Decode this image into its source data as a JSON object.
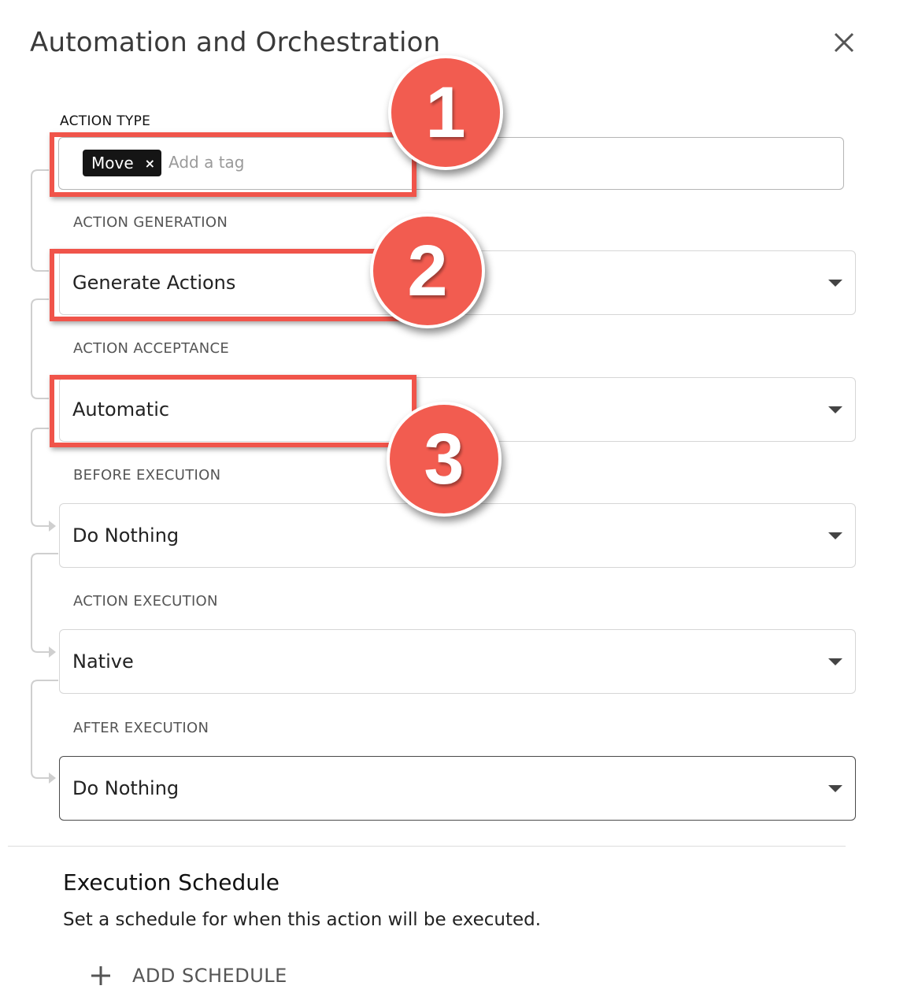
{
  "dialog": {
    "title": "Automation and Orchestration",
    "close_icon": "close-icon"
  },
  "fields": {
    "action_type": {
      "label": "ACTION TYPE",
      "tags": [
        "Move"
      ],
      "tag_remove": "×",
      "placeholder": "Add a tag"
    },
    "action_generation": {
      "label": "ACTION GENERATION",
      "value": "Generate Actions"
    },
    "action_acceptance": {
      "label": "ACTION ACCEPTANCE",
      "value": "Automatic"
    },
    "before_execution": {
      "label": "BEFORE EXECUTION",
      "value": "Do Nothing"
    },
    "action_execution": {
      "label": "ACTION EXECUTION",
      "value": "Native"
    },
    "after_execution": {
      "label": "AFTER EXECUTION",
      "value": "Do Nothing"
    }
  },
  "annotations": {
    "badges": [
      "1",
      "2",
      "3"
    ],
    "accent_color": "#f0544a"
  },
  "schedule": {
    "title": "Execution Schedule",
    "description": "Set a schedule for when this action will be executed.",
    "add_button": "ADD SCHEDULE"
  }
}
